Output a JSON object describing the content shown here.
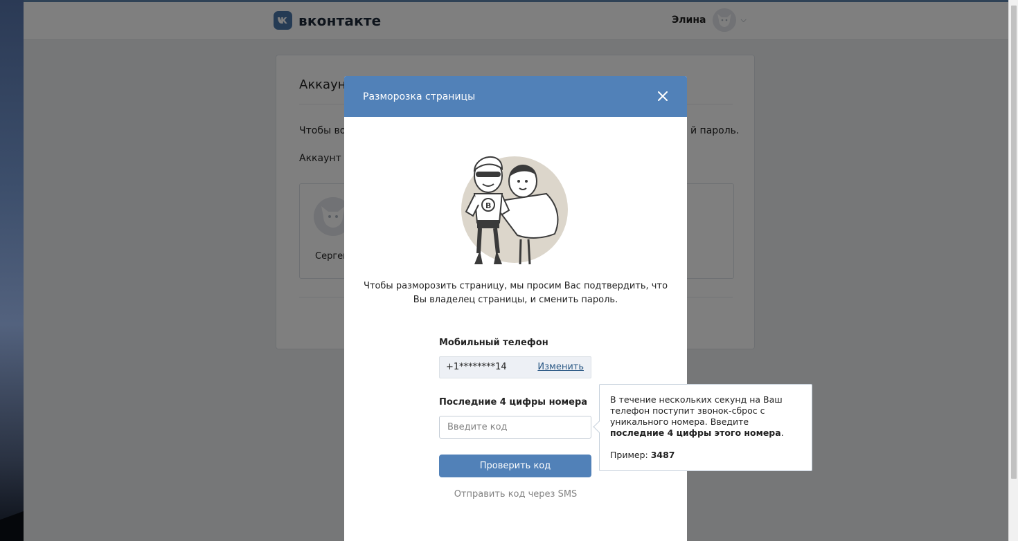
{
  "header": {
    "logo_text": "вконтакте",
    "user_name": "Элина"
  },
  "background_card": {
    "title": "Аккаунт",
    "text_line1_start": "Чтобы во",
    "text_line1_end": "й пароль.",
    "text_line2_start": "Аккаунт з",
    "account_name": "Сергей"
  },
  "modal": {
    "title": "Разморозка страницы",
    "intro_line1": "Чтобы разморозить страницу, мы просим Вас подтвердить, что",
    "intro_line2": "Вы владелец страницы, и сменить пароль.",
    "phone_label": "Мобильный телефон",
    "phone_value": "+1********14",
    "change_link": "Изменить",
    "code_label": "Последние 4 цифры номера",
    "code_placeholder": "Введите код",
    "check_button": "Проверить код",
    "sms_link": "Отправить код через SMS"
  },
  "tooltip": {
    "text_part1": "В течение нескольких секунд на Ваш телефон поступит звонок-сброс с уникального номера. Введите ",
    "text_bold": "последние 4 цифры этого номера",
    "text_part2": ".",
    "example_label": "Пример: ",
    "example_value": "3487"
  },
  "colors": {
    "brand_blue": "#5181b8",
    "link_blue": "#2a5885",
    "logo_blue": "#4a76a8"
  }
}
